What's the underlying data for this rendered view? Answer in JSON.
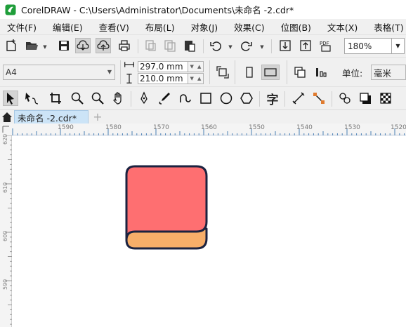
{
  "window": {
    "title": "CorelDRAW - C:\\Users\\Administrator\\Documents\\未命名 -2.cdr*"
  },
  "menubar": {
    "items": [
      "文件(F)",
      "编辑(E)",
      "查看(V)",
      "布局(L)",
      "对象(J)",
      "效果(C)",
      "位图(B)",
      "文本(X)",
      "表格(T)"
    ]
  },
  "toolbar": {
    "zoom_value": "180%",
    "pdf_label": "PDF"
  },
  "property_bar": {
    "page_size": "A4",
    "width": "297.0 mm",
    "height": "210.0 mm",
    "units_label": "单位:",
    "units_value": "毫米"
  },
  "toolbox": {
    "text_tool_glyph": "字"
  },
  "document_tab": {
    "label": "未命名 -2.cdr*",
    "add_label": "+"
  },
  "ruler": {
    "h_labels": [
      "1590",
      "1580",
      "1570",
      "1560",
      "1550",
      "1540",
      "1530",
      "1520"
    ],
    "v_labels": [
      "620",
      "610",
      "600",
      "590"
    ]
  },
  "colors": {
    "book_cover": "#fe6f71",
    "book_pages": "#f7ae69",
    "outline": "#1b2240",
    "tab_active": "#cce4f7",
    "toolbar_bg": "#f0f0f0"
  }
}
